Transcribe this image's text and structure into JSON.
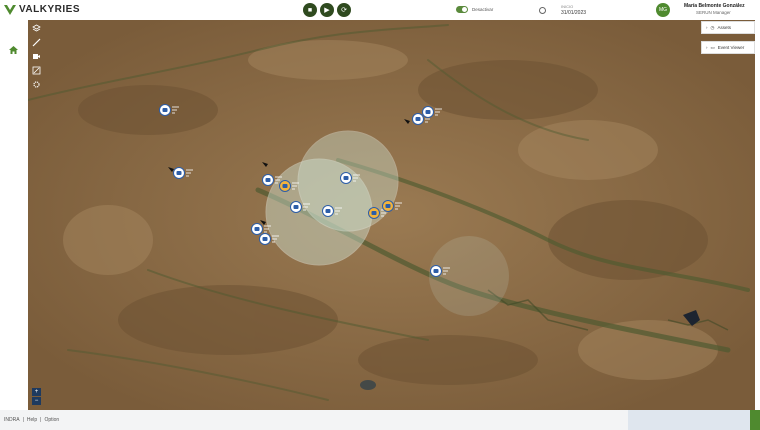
{
  "app": {
    "name": "VALKYRIES"
  },
  "header": {
    "controls": [
      {
        "name": "stop-icon",
        "glyph": "■"
      },
      {
        "name": "play-icon",
        "glyph": "▶"
      },
      {
        "name": "replay-icon",
        "glyph": "⟳"
      }
    ],
    "toggle_label": "Desactivar",
    "date_label": "INICIO",
    "date_value": "31/01/2023",
    "user": {
      "initials": "MG",
      "name": "María Belmonte González",
      "role": "SERUN Manager"
    }
  },
  "map": {
    "tools": [
      "layers-icon",
      "measure-icon",
      "camera-icon",
      "draw-icon",
      "settings-icon"
    ],
    "panels": [
      {
        "label": "Assets",
        "icon": "clock-icon"
      },
      {
        "label": "Event Viewer",
        "icon": "monitor-icon"
      }
    ],
    "zoom": {
      "in": "+",
      "out": "−"
    }
  },
  "footer": {
    "links": [
      "INDRA",
      "Help",
      "Option"
    ]
  },
  "colors": {
    "brand_green": "#4f8a2f",
    "marker_blue": "#2c5da8"
  }
}
